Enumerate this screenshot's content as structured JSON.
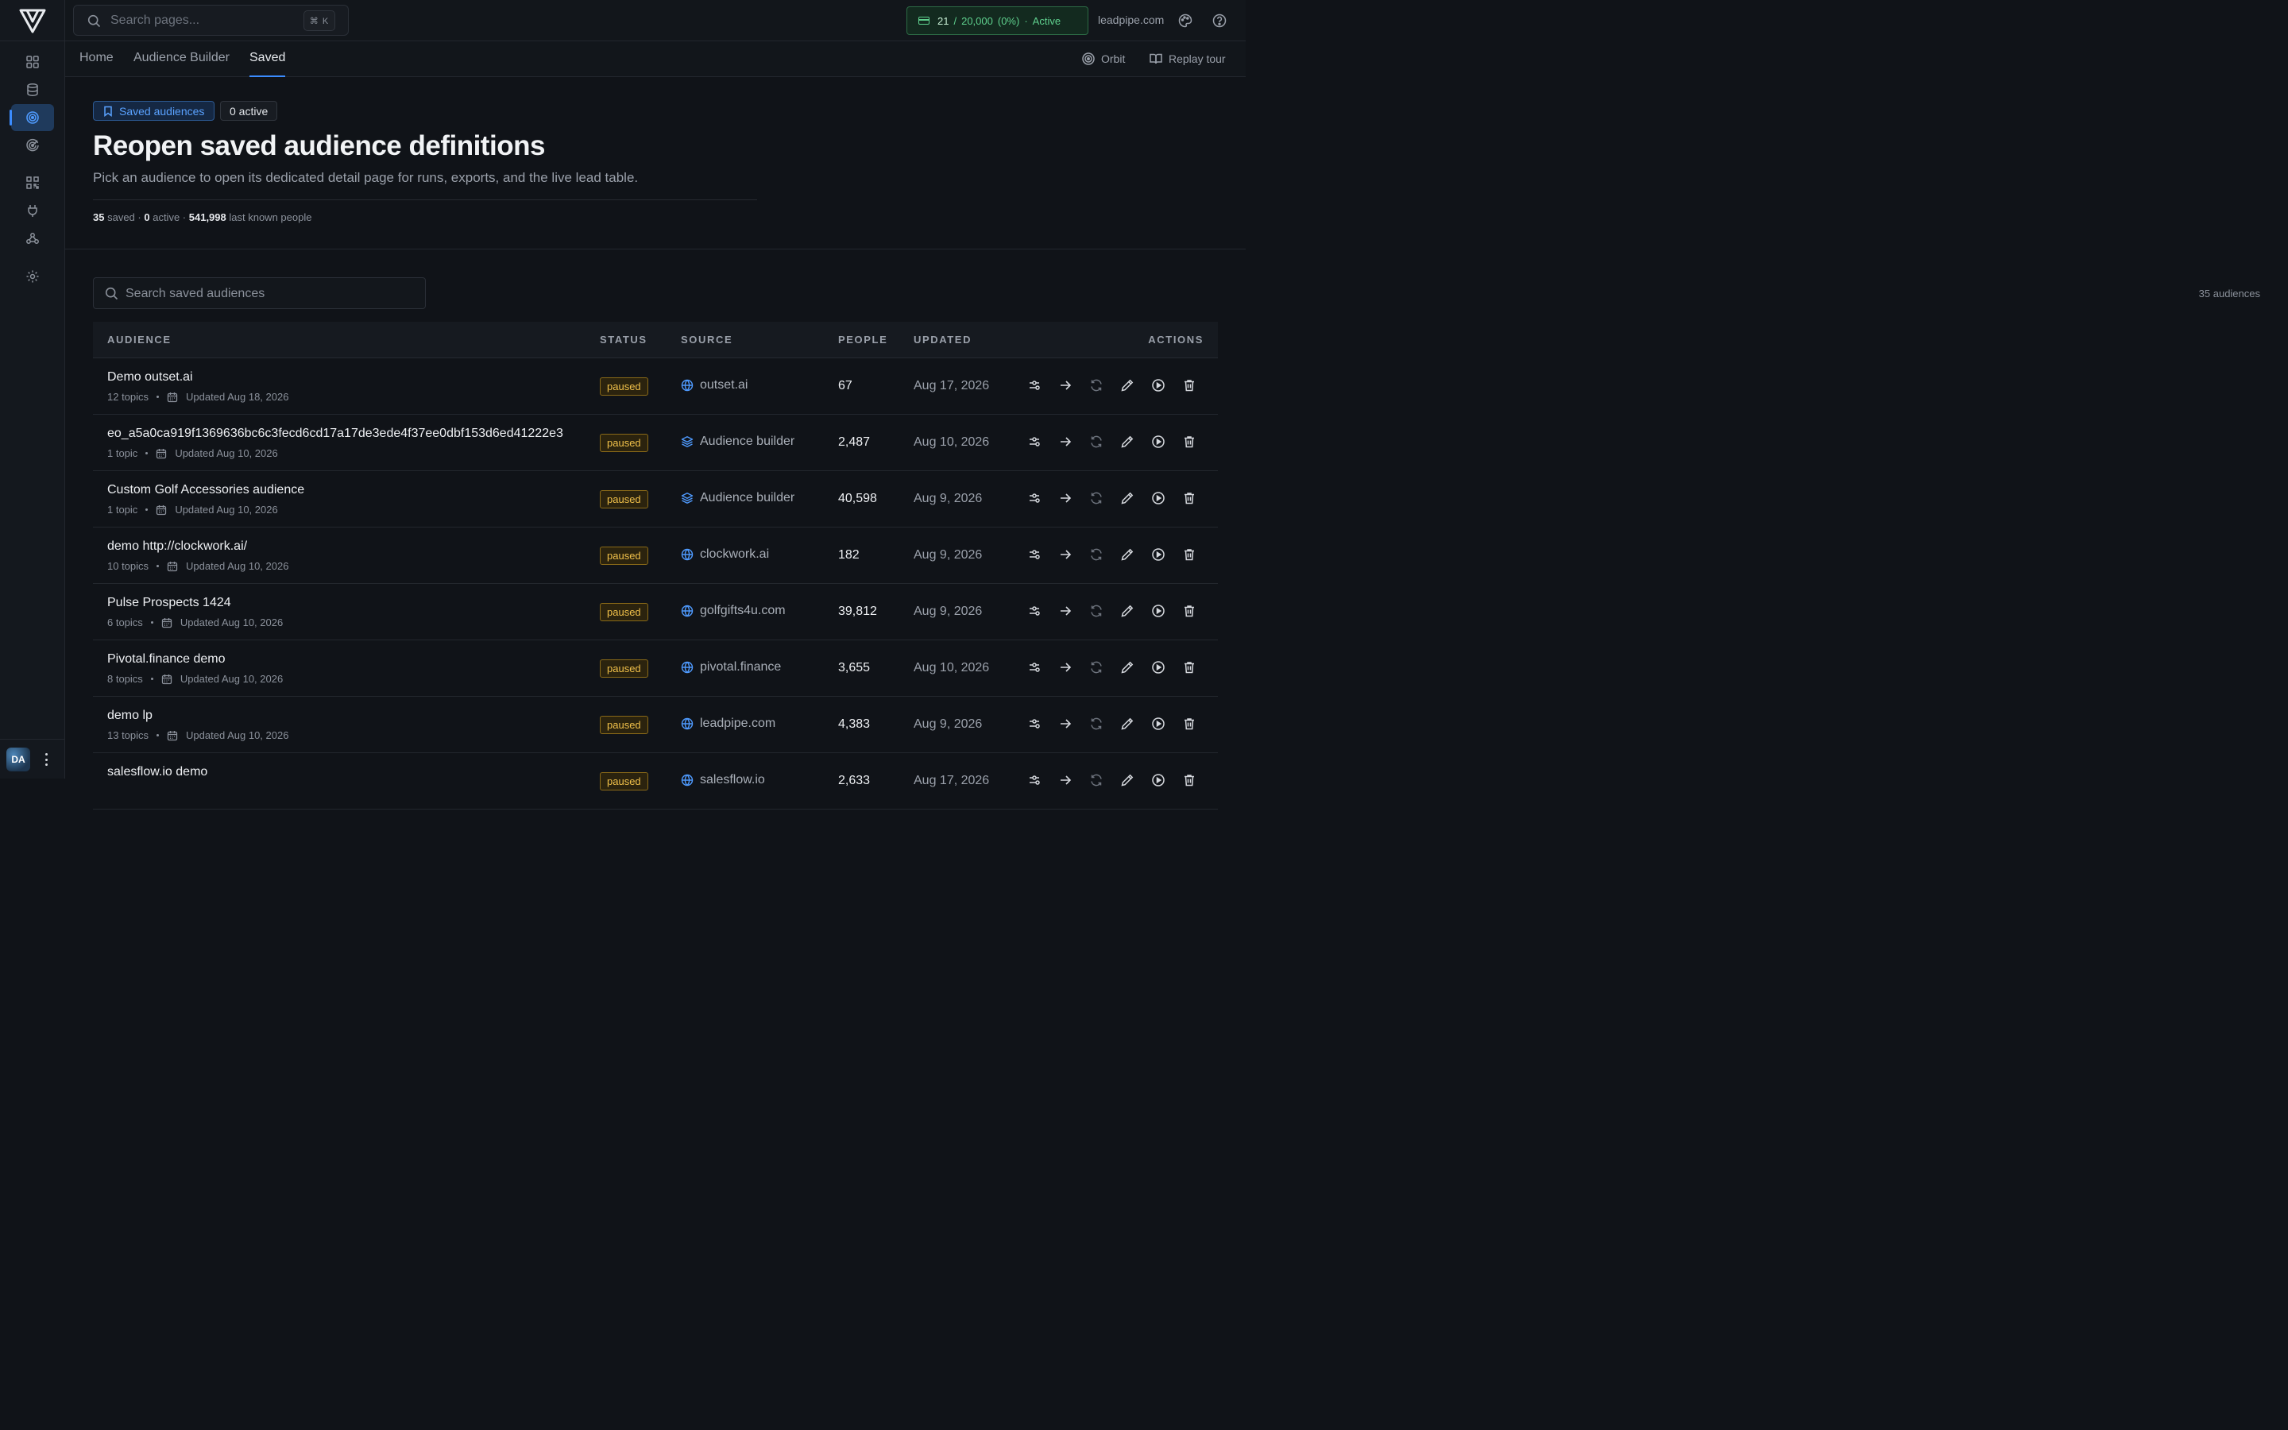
{
  "app": {
    "logo": "leadpipe-logo"
  },
  "sidebar": {
    "items": [
      {
        "icon": "dashboard-grid-icon",
        "active": false
      },
      {
        "icon": "database-icon",
        "active": false
      },
      {
        "icon": "target-icon",
        "active": true
      },
      {
        "icon": "radar-icon",
        "active": false
      },
      {
        "icon": "qr-scan-icon",
        "active": false
      },
      {
        "icon": "plug-icon",
        "active": false
      },
      {
        "icon": "webhook-icon",
        "active": false
      },
      {
        "icon": "gear-icon",
        "active": false
      }
    ],
    "avatar": "DA"
  },
  "topbar": {
    "search_placeholder": "Search pages...",
    "shortcut": "⌘ K",
    "usage": {
      "used": "21",
      "sep": "/",
      "limit": "20,000",
      "pct": "(0%)",
      "dot": "·",
      "status": "Active"
    },
    "domain": "leadpipe.com"
  },
  "subnav": {
    "tabs": [
      "Home",
      "Audience Builder",
      "Saved"
    ],
    "active_tab": "Saved",
    "orbit": "Orbit",
    "replay": "Replay tour"
  },
  "hero": {
    "pill_saved": "Saved audiences",
    "pill_active": "0 active",
    "title": "Reopen saved audience definitions",
    "subtitle": "Pick an audience to open its dedicated detail page for runs, exports, and the live lead table.",
    "stats": {
      "saved_n": "35",
      "saved_l": "saved ·",
      "active_n": "0",
      "active_l": "active ·",
      "people_n": "541,998",
      "people_l": "last known people"
    }
  },
  "list": {
    "search_placeholder": "Search saved audiences",
    "count": "35 audiences",
    "headers": {
      "audience": "AUDIENCE",
      "status": "STATUS",
      "source": "SOURCE",
      "people": "PEOPLE",
      "updated": "UPDATED",
      "actions": "ACTIONS"
    },
    "rows": [
      {
        "name": "Demo outset.ai",
        "topics": "12 topics",
        "meta_updated": "Updated Aug 18, 2026",
        "status": "paused",
        "source_icon": "globe-icon",
        "source": "outset.ai",
        "people": "67",
        "updated": "Aug 17, 2026"
      },
      {
        "name": "eo_a5a0ca919f1369636bc6c3fecd6cd17a17de3ede4f37ee0dbf153d6ed41222e3",
        "topics": "1 topic",
        "meta_updated": "Updated Aug 10, 2026",
        "status": "paused",
        "source_icon": "layers-icon",
        "source": "Audience builder",
        "people": "2,487",
        "updated": "Aug 10, 2026"
      },
      {
        "name": "Custom Golf Accessories audience",
        "topics": "1 topic",
        "meta_updated": "Updated Aug 10, 2026",
        "status": "paused",
        "source_icon": "layers-icon",
        "source": "Audience builder",
        "people": "40,598",
        "updated": "Aug 9, 2026"
      },
      {
        "name": "demo http://clockwork.ai/",
        "topics": "10 topics",
        "meta_updated": "Updated Aug 10, 2026",
        "status": "paused",
        "source_icon": "globe-icon",
        "source": "clockwork.ai",
        "people": "182",
        "updated": "Aug 9, 2026"
      },
      {
        "name": "Pulse Prospects 1424",
        "topics": "6 topics",
        "meta_updated": "Updated Aug 10, 2026",
        "status": "paused",
        "source_icon": "globe-icon",
        "source": "golfgifts4u.com",
        "people": "39,812",
        "updated": "Aug 9, 2026"
      },
      {
        "name": "Pivotal.finance demo",
        "topics": "8 topics",
        "meta_updated": "Updated Aug 10, 2026",
        "status": "paused",
        "source_icon": "globe-icon",
        "source": "pivotal.finance",
        "people": "3,655",
        "updated": "Aug 10, 2026"
      },
      {
        "name": "demo lp",
        "topics": "13 topics",
        "meta_updated": "Updated Aug 10, 2026",
        "status": "paused",
        "source_icon": "globe-icon",
        "source": "leadpipe.com",
        "people": "4,383",
        "updated": "Aug 9, 2026"
      },
      {
        "name": "salesflow.io demo",
        "topics": "",
        "meta_updated": "",
        "status": "paused",
        "source_icon": "globe-icon",
        "source": "salesflow.io",
        "people": "2,633",
        "updated": "Aug 17, 2026"
      }
    ],
    "row_actions": [
      "filters-icon",
      "arrow-right-icon",
      "refresh-icon",
      "pencil-icon",
      "play-circle-icon",
      "trash-icon"
    ]
  }
}
